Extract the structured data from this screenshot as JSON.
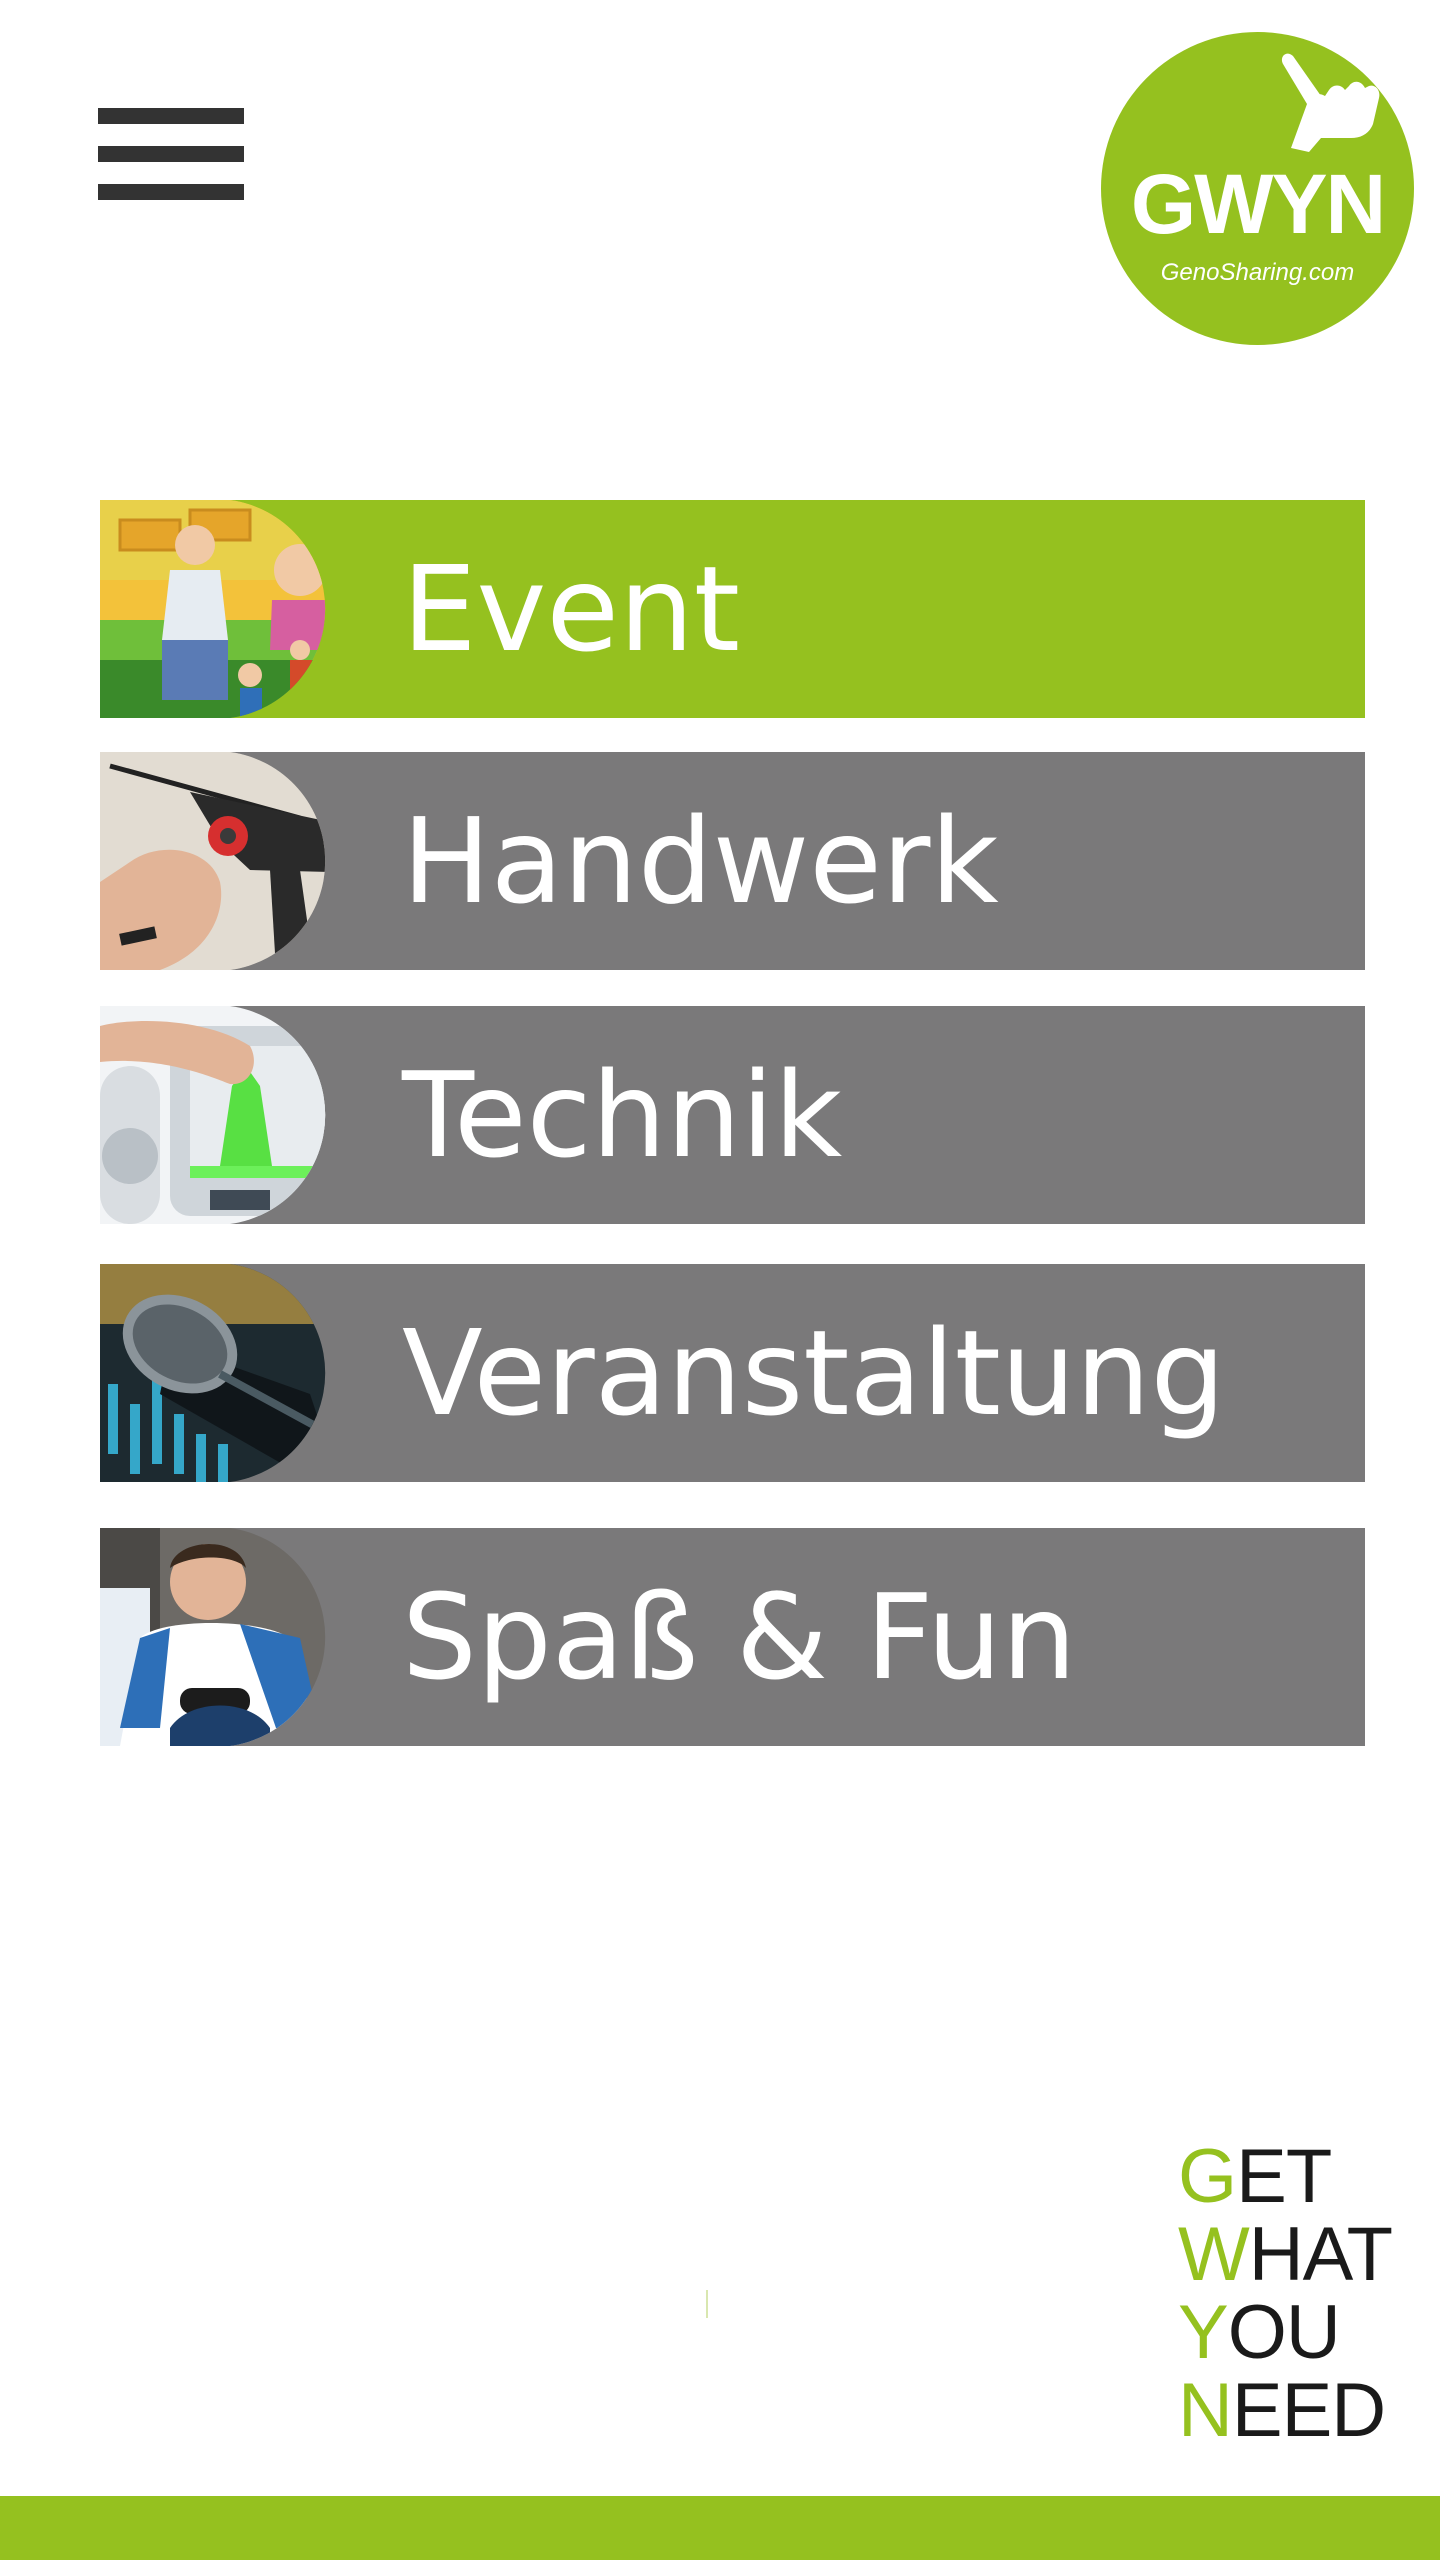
{
  "header": {
    "menu_icon": "hamburger-menu-icon",
    "logo": {
      "title": "GWYN",
      "subtitle": "GenoSharing.com",
      "icon": "pointing-hand-icon"
    }
  },
  "categories": [
    {
      "label": "Event",
      "icon": "children-bouncy-castle-photo",
      "active": true
    },
    {
      "label": "Handwerk",
      "icon": "power-drill-photo",
      "active": false
    },
    {
      "label": "Technik",
      "icon": "3d-printer-photo",
      "active": false
    },
    {
      "label": "Veranstaltung",
      "icon": "microphone-mixer-photo",
      "active": false
    },
    {
      "label": "Spaß & Fun",
      "icon": "gamer-man-photo",
      "active": false
    }
  ],
  "slogan": {
    "lines": [
      {
        "first": "G",
        "rest": "ET"
      },
      {
        "first": "W",
        "rest": "HAT"
      },
      {
        "first": "Y",
        "rest": "OU"
      },
      {
        "first": "N",
        "rest": "EED"
      }
    ]
  },
  "colors": {
    "brand_green": "#95c11f",
    "category_gray": "#7a797a",
    "text_dark": "#1a1a1a",
    "menu_icon": "#333333"
  }
}
